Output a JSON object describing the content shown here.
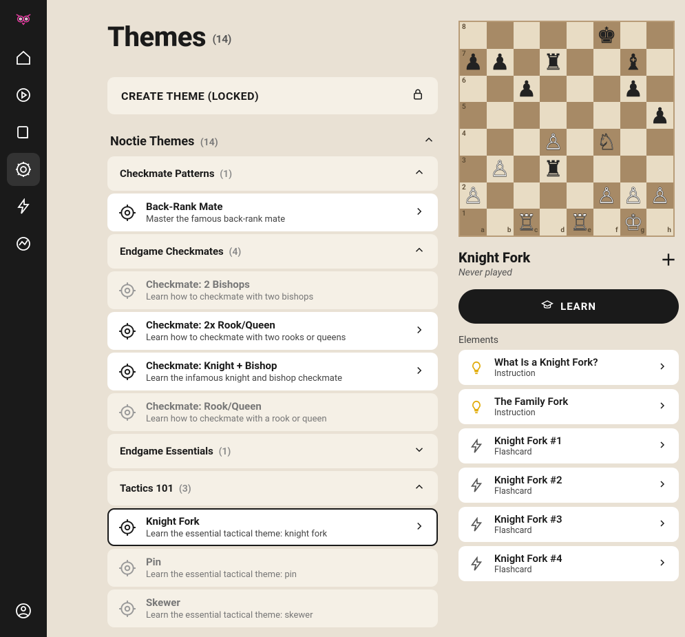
{
  "page": {
    "title": "Themes",
    "count": "(14)"
  },
  "create": {
    "label": "CREATE THEME (LOCKED)"
  },
  "section": {
    "title": "Noctie Themes",
    "count": "(14)"
  },
  "groups": [
    {
      "title": "Checkmate Patterns",
      "count": "(1)",
      "expanded": true,
      "items": [
        {
          "title": "Back-Rank Mate",
          "sub": "Master the famous back-rank mate",
          "locked": false,
          "selected": false
        }
      ]
    },
    {
      "title": "Endgame Checkmates",
      "count": "(4)",
      "expanded": true,
      "items": [
        {
          "title": "Checkmate: 2 Bishops",
          "sub": "Learn how to checkmate with two bishops",
          "locked": true
        },
        {
          "title": "Checkmate: 2x Rook/Queen",
          "sub": "Learn how to checkmate with two rooks or queens",
          "locked": false
        },
        {
          "title": "Checkmate: Knight + Bishop",
          "sub": "Learn the infamous knight and bishop checkmate",
          "locked": false
        },
        {
          "title": "Checkmate: Rook/Queen",
          "sub": "Learn how to checkmate with a rook or queen",
          "locked": true
        }
      ]
    },
    {
      "title": "Endgame Essentials",
      "count": "(1)",
      "expanded": false,
      "items": []
    },
    {
      "title": "Tactics 101",
      "count": "(3)",
      "expanded": true,
      "items": [
        {
          "title": "Knight Fork",
          "sub": "Learn the essential tactical theme: knight fork",
          "locked": false,
          "selected": true
        },
        {
          "title": "Pin",
          "sub": "Learn the essential tactical theme: pin",
          "locked": true
        },
        {
          "title": "Skewer",
          "sub": "Learn the essential tactical theme: skewer",
          "locked": true
        }
      ]
    }
  ],
  "detail": {
    "title": "Knight Fork",
    "status": "Never played",
    "learn_label": "LEARN",
    "elements_label": "Elements",
    "elements": [
      {
        "title": "What Is a Knight Fork?",
        "sub": "Instruction",
        "kind": "instruction"
      },
      {
        "title": "The Family Fork",
        "sub": "Instruction",
        "kind": "instruction"
      },
      {
        "title": "Knight Fork #1",
        "sub": "Flashcard",
        "kind": "flashcard"
      },
      {
        "title": "Knight Fork #2",
        "sub": "Flashcard",
        "kind": "flashcard"
      },
      {
        "title": "Knight Fork #3",
        "sub": "Flashcard",
        "kind": "flashcard"
      },
      {
        "title": "Knight Fork #4",
        "sub": "Flashcard",
        "kind": "flashcard"
      }
    ]
  },
  "board": {
    "ranks": [
      "8",
      "7",
      "6",
      "5",
      "4",
      "3",
      "2",
      "1"
    ],
    "files": [
      "a",
      "b",
      "c",
      "d",
      "e",
      "f",
      "g",
      "h"
    ],
    "position": {
      "a8": "",
      "b8": "",
      "c8": "",
      "d8": "",
      "e8": "",
      "f8": "bk",
      "g8": "",
      "h8": "",
      "a7": "bp",
      "b7": "bp",
      "c7": "",
      "d7": "br",
      "e7": "",
      "f7": "",
      "g7": "bb",
      "h7": "",
      "a6": "",
      "b6": "",
      "c6": "bp",
      "d6": "",
      "e6": "",
      "f6": "",
      "g6": "bp",
      "h6": "",
      "a5": "",
      "b5": "",
      "c5": "",
      "d5": "",
      "e5": "",
      "f5": "",
      "g5": "",
      "h5": "bp",
      "a4": "",
      "b4": "",
      "c4": "",
      "d4": "wp",
      "e4": "",
      "f4": "wn",
      "g4": "",
      "h4": "",
      "a3": "",
      "b3": "wp",
      "c3": "",
      "d3": "br",
      "e3": "",
      "f3": "",
      "g3": "",
      "h3": "",
      "a2": "wp",
      "b2": "",
      "c2": "",
      "d2": "",
      "e2": "",
      "f2": "wp",
      "g2": "wp",
      "h2": "wp",
      "a1": "",
      "b1": "",
      "c1": "wr",
      "d1": "",
      "e1": "wr",
      "f1": "",
      "g1": "wk",
      "h1": ""
    }
  }
}
